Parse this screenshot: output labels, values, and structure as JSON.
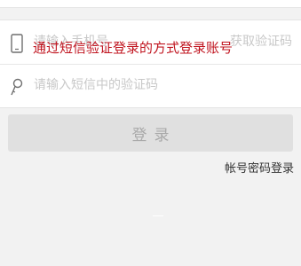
{
  "annotation": {
    "text": "通过短信验证登录的方式登录账号",
    "color": "#c0141f"
  },
  "phone": {
    "icon": "phone-icon",
    "placeholder": "请输入手机号",
    "get_code_label": "获取验证码"
  },
  "code": {
    "icon": "key-icon",
    "placeholder": "请输入短信中的验证码"
  },
  "login_button": {
    "label": "登录"
  },
  "alt_login": {
    "label": "帐号密码登录"
  }
}
